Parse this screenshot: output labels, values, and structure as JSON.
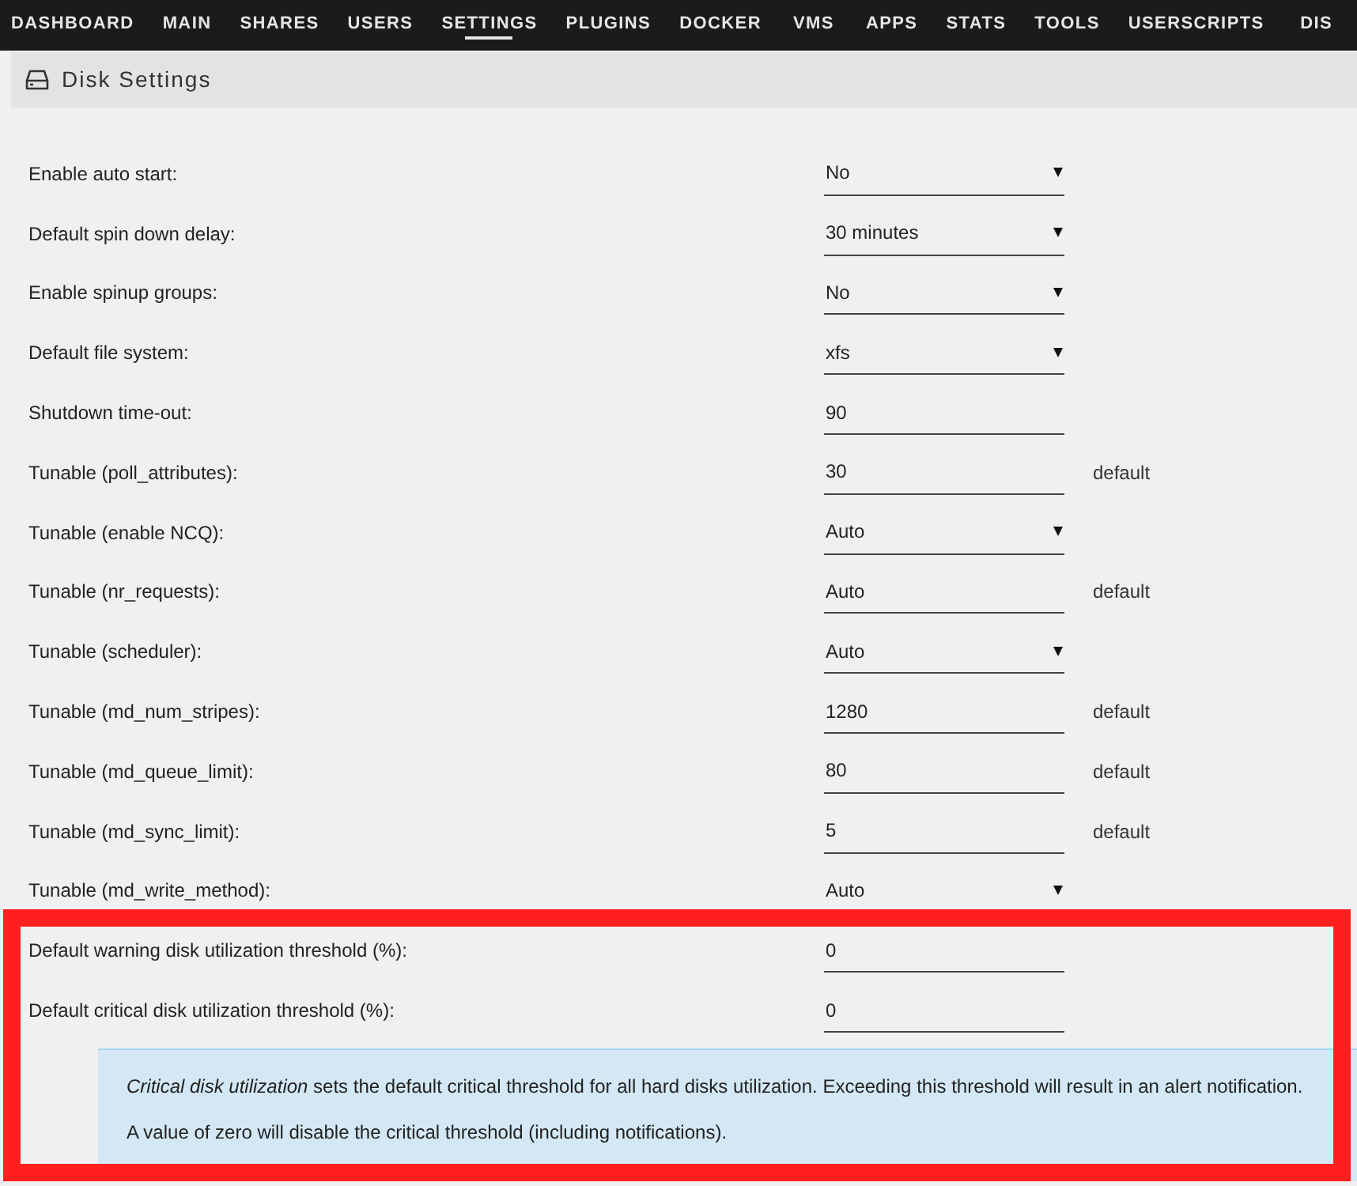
{
  "nav": {
    "items": [
      {
        "label": "DASHBOARD",
        "selected": false
      },
      {
        "label": "MAIN",
        "selected": false
      },
      {
        "label": "SHARES",
        "selected": false
      },
      {
        "label": "USERS",
        "selected": false
      },
      {
        "label": "SETTINGS",
        "selected": true
      },
      {
        "label": "PLUGINS",
        "selected": false
      },
      {
        "label": "DOCKER",
        "selected": false
      },
      {
        "label": "VMS",
        "selected": false
      },
      {
        "label": "APPS",
        "selected": false
      },
      {
        "label": "STATS",
        "selected": false
      },
      {
        "label": "TOOLS",
        "selected": false
      },
      {
        "label": "USERSCRIPTS",
        "selected": false
      },
      {
        "label": "DIS",
        "selected": false
      }
    ]
  },
  "panel": {
    "title": "Disk Settings"
  },
  "sections": [
    {
      "highlighted": false,
      "settings": [
        {
          "label": "Enable auto start:",
          "kind": "select",
          "value": "No"
        },
        {
          "label": "Default spin down delay:",
          "kind": "select",
          "value": "30 minutes"
        },
        {
          "label": "Enable spinup groups:",
          "kind": "select",
          "value": "No"
        },
        {
          "label": "Default file system:",
          "kind": "select",
          "value": "xfs"
        },
        {
          "label": "Shutdown time-out:",
          "kind": "input",
          "value": "90"
        },
        {
          "label": "Tunable (poll_attributes):",
          "kind": "input",
          "value": "30",
          "note": "default"
        },
        {
          "label": "Tunable (enable NCQ):",
          "kind": "select",
          "value": "Auto"
        },
        {
          "label": "Tunable (nr_requests):",
          "kind": "input",
          "value": "Auto",
          "note": "default"
        },
        {
          "label": "Tunable (scheduler):",
          "kind": "select",
          "value": "Auto"
        },
        {
          "label": "Tunable (md_num_stripes):",
          "kind": "input",
          "value": "1280",
          "note": "default"
        },
        {
          "label": "Tunable (md_queue_limit):",
          "kind": "input",
          "value": "80",
          "note": "default"
        },
        {
          "label": "Tunable (md_sync_limit):",
          "kind": "input",
          "value": "5",
          "note": "default"
        },
        {
          "label": "Tunable (md_write_method):",
          "kind": "select",
          "value": "Auto"
        }
      ]
    },
    {
      "highlighted": true,
      "settings": [
        {
          "label": "Default warning disk utilization threshold (%):",
          "kind": "input",
          "value": "0"
        },
        {
          "label": "Default critical disk utilization threshold (%):",
          "kind": "input",
          "value": "0"
        }
      ],
      "help": [
        "*Critical disk utilization* sets the default critical threshold for all hard disks utilization. Exceeding this threshold will result in an alert notification.",
        "A value of zero will disable the critical threshold (including notifications)."
      ]
    }
  ]
}
